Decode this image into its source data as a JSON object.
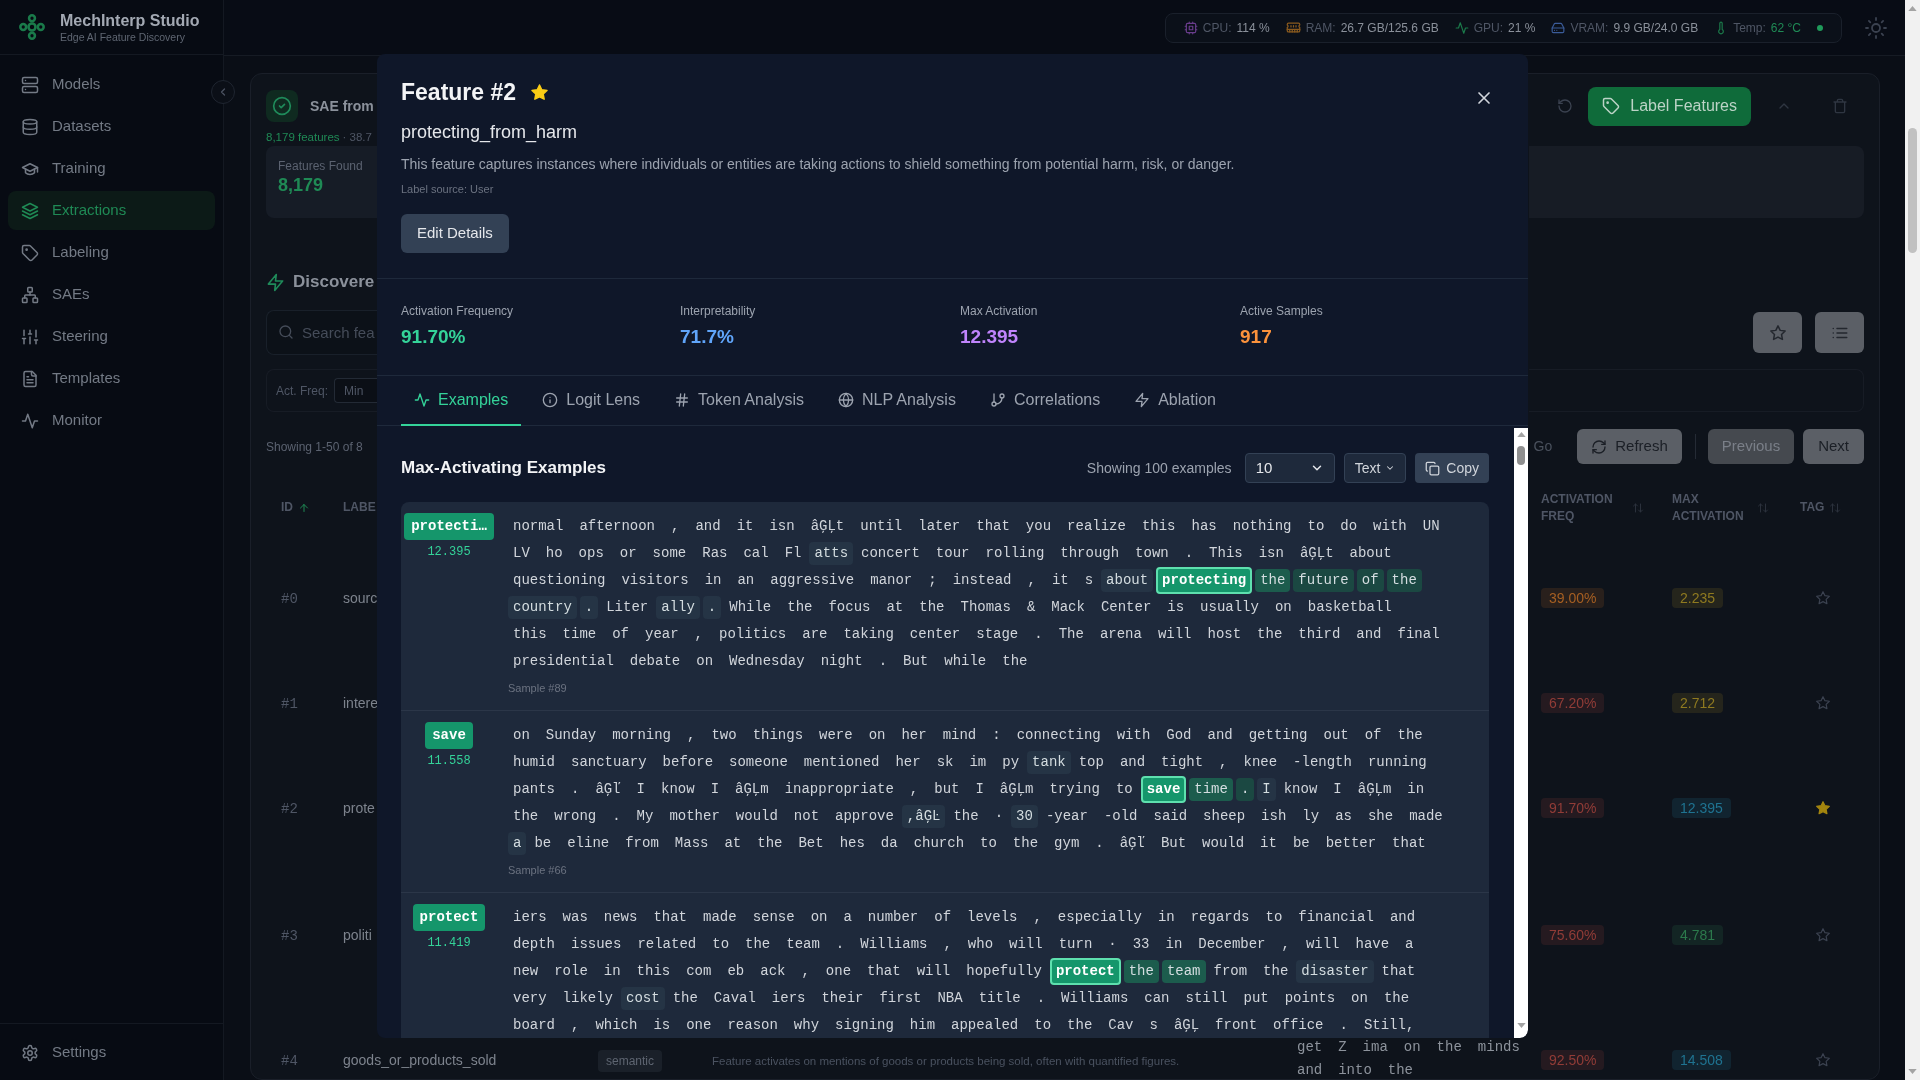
{
  "app": {
    "title": "MechInterp Studio",
    "subtitle": "Edge AI Feature Discovery"
  },
  "sidebar": {
    "items": [
      {
        "label": "Models",
        "selected": false
      },
      {
        "label": "Datasets",
        "selected": false
      },
      {
        "label": "Training",
        "selected": false
      },
      {
        "label": "Extractions",
        "selected": true
      },
      {
        "label": "Labeling",
        "selected": false
      },
      {
        "label": "SAEs",
        "selected": false
      },
      {
        "label": "Steering",
        "selected": false
      },
      {
        "label": "Templates",
        "selected": false
      },
      {
        "label": "Monitor",
        "selected": false
      }
    ],
    "footer_item": {
      "label": "Settings"
    }
  },
  "status_bar": {
    "items": [
      {
        "kind": "cpu",
        "label": "CPU:",
        "value": "114 %"
      },
      {
        "kind": "ram",
        "label": "RAM:",
        "value": "26.7 GB/125.6 GB"
      },
      {
        "kind": "gpu",
        "label": "GPU:",
        "value": "21 %"
      },
      {
        "kind": "vram",
        "label": "VRAM:",
        "value": "9.9 GB/24.0 GB"
      },
      {
        "kind": "temp",
        "label": "Temp:",
        "value": "62 °C"
      }
    ],
    "online": true
  },
  "extraction": {
    "title": "SAE from",
    "features": "8,179 features",
    "meta": "· 38.7",
    "stat": {
      "label": "Features Found",
      "value": "8,179"
    },
    "label_button": "Label Features"
  },
  "features_section": {
    "title": "Discovere",
    "search": {
      "placeholder": "Search fea"
    },
    "filter": {
      "label": "Act. Freq:",
      "min": {
        "placeholder": "Min"
      }
    },
    "showing": "Showing 1-50 of 8",
    "go": {
      "label": "Go",
      "disabled": true
    },
    "refresh": "Refresh",
    "previous": {
      "label": "Previous",
      "disabled": true
    },
    "next": {
      "label": "Next",
      "disabled": false
    }
  },
  "table": {
    "columns": [
      {
        "label": "ID",
        "sortable": true,
        "sorted": true
      },
      {
        "label": "LABE"
      },
      {
        "label": "ACTIVATION FREQ",
        "sortable": true,
        "sorted": false
      },
      {
        "label": "MAX ACTIVATION",
        "sortable": true,
        "sorted": false
      },
      {
        "label": "TAG",
        "sortable": true,
        "sorted": false
      }
    ],
    "rows": [
      {
        "id": "#0",
        "label": "sourc",
        "activation_freq": {
          "text": "39.00%",
          "color": "#a65f22"
        },
        "max_activation": {
          "text": "2.235",
          "color": "#8f7a20"
        },
        "starred": false
      },
      {
        "id": "#1",
        "label": "intere",
        "activation_freq": {
          "text": "67.20%",
          "color": "#913c37"
        },
        "max_activation": {
          "text": "2.712",
          "color": "#8f7a20"
        },
        "starred": false
      },
      {
        "id": "#2",
        "label": "prote",
        "activation_freq": {
          "text": "91.70%",
          "color": "#913c37"
        },
        "max_activation": {
          "text": "12.395",
          "color": "#1f7391"
        },
        "starred": true
      },
      {
        "id": "#3",
        "label": "politi",
        "activation_freq": {
          "text": "75.60%",
          "color": "#913c37"
        },
        "max_activation": {
          "text": "4.781",
          "color": "#2c7a4c"
        },
        "starred": false
      },
      {
        "id": "#4",
        "label": "goods_or_products_sold",
        "category": "semantic",
        "description": "Feature activates on mentions of goods or products being sold, often with quantified figures.",
        "activation_freq": {
          "text": "92.50%",
          "color": "#913c37"
        },
        "max_activation": {
          "text": "14.508",
          "color": "#1f7391"
        },
        "starred": false
      }
    ]
  },
  "modal": {
    "title": "Feature #2",
    "starred": true,
    "name": "protecting_from_harm",
    "description": "This feature captures instances where individuals or entities are taking actions to shield something from potential harm, risk, or danger.",
    "label_source": "Label source: User",
    "edit_button": "Edit Details",
    "stats": [
      {
        "label": "Activation Frequency",
        "value": "91.70%",
        "color": "#34d399"
      },
      {
        "label": "Interpretability",
        "value": "71.7%",
        "color": "#60a5fa"
      },
      {
        "label": "Max Activation",
        "value": "12.395",
        "color": "#c084fc"
      },
      {
        "label": "Active Samples",
        "value": "917",
        "color": "#fb923c"
      }
    ],
    "tabs": [
      {
        "label": "Examples",
        "selected": true
      },
      {
        "label": "Logit Lens",
        "selected": false
      },
      {
        "label": "Token Analysis",
        "selected": false
      },
      {
        "label": "NLP Analysis",
        "selected": false
      },
      {
        "label": "Correlations",
        "selected": false
      },
      {
        "label": "Ablation",
        "selected": false
      }
    ],
    "examples_panel": {
      "title": "Max-Activating Examples",
      "count": "Showing 100 examples",
      "page_size": "10",
      "view": "Text",
      "copy_button": "Copy",
      "examples": [
        {
          "token": "protecti…",
          "activation": "12.395",
          "lines": [
            [
              {
                "text": "normal afternoon , and it isn âĢĻt until later that you realize this has nothing to do with UN"
              }
            ],
            [
              {
                "text": "LV ho ops or some Ras cal Fl"
              },
              {
                "text": "atts",
                "color": "#253445",
                "peak": false
              },
              {
                "text": "concert tour rolling through town . This isn âĢĻt about"
              }
            ],
            [
              {
                "text": "questioning visitors in an aggressive manor ; instead , it s"
              },
              {
                "text": "about",
                "color": "#253445",
                "peak": false
              },
              {
                "text": "protecting",
                "color": "#15966b",
                "peak": true
              },
              {
                "text": "the",
                "color": "#1c5c4d",
                "peak": false
              },
              {
                "text": "future",
                "color": "#1b4842",
                "peak": false
              },
              {
                "text": "of",
                "color": "#1b4842",
                "peak": false
              },
              {
                "text": "the",
                "color": "#1b4842",
                "peak": false
              }
            ],
            [
              {
                "text": "country",
                "color": "#253445",
                "peak": false
              },
              {
                "text": ".",
                "color": "#253445",
                "peak": false
              },
              {
                "text": "Liter"
              },
              {
                "text": "ally",
                "color": "#253445",
                "peak": false
              },
              {
                "text": ".",
                "color": "#253445",
                "peak": false
              },
              {
                "text": "While the focus at the Thomas & Mack Center is usually on basketball"
              }
            ],
            [
              {
                "text": "this time of year , politics are taking center stage . The arena will host the third and final"
              }
            ],
            [
              {
                "text": "presidential debate on Wednesday night . But while the"
              }
            ]
          ],
          "sample": "Sample #89"
        },
        {
          "token": "save",
          "activation": "11.558",
          "lines": [
            [
              {
                "text": "on Sunday morning , two things were on her mind : connecting with God and getting out of the"
              }
            ],
            [
              {
                "text": "humid sanctuary before someone mentioned her sk im py"
              },
              {
                "text": "tank",
                "color": "#253445",
                "peak": false
              },
              {
                "text": "top and tight , knee -length running"
              }
            ],
            [
              {
                "text": "pants . âĢľ I know I âĢĻm inappropriate , but I âĢĻm trying to"
              },
              {
                "text": "save",
                "color": "#15966b",
                "peak": true
              },
              {
                "text": "time",
                "color": "#1c5c4d",
                "peak": false
              },
              {
                "text": ".",
                "color": "#1b4842",
                "peak": false
              },
              {
                "text": "I",
                "color": "#253445",
                "peak": false
              },
              {
                "text": "know I âĢĻm in"
              }
            ],
            [
              {
                "text": "the wrong . My mother would not approve"
              },
              {
                "text": ",âĢĿ",
                "color": "#253445",
                "peak": false
              },
              {
                "text": "the ·"
              },
              {
                "text": "30",
                "color": "#253445",
                "peak": false
              },
              {
                "text": "-year -old said sheep ish ly as she made"
              }
            ],
            [
              {
                "text": "a",
                "color": "#253445",
                "peak": false
              },
              {
                "text": "be eline from Mass at the Bet hes da church to the gym . âĢľ But would it be better that"
              }
            ]
          ],
          "sample": "Sample #66"
        },
        {
          "token": "protect",
          "activation": "11.419",
          "lines": [
            [
              {
                "text": "iers was news that made sense on a number of levels , especially in regards to financial and"
              }
            ],
            [
              {
                "text": "depth issues related to the team . Williams , who will turn · 33 in December , will have a"
              }
            ],
            [
              {
                "text": "new role in this com eb ack , one that will hopefully"
              },
              {
                "text": "protect",
                "color": "#15966b",
                "peak": true
              },
              {
                "text": "the",
                "color": "#1c5c4d",
                "peak": false
              },
              {
                "text": "team",
                "color": "#1c5c4d",
                "peak": false
              },
              {
                "text": "from the"
              },
              {
                "text": "disaster",
                "color": "#253445",
                "peak": false
              },
              {
                "text": "that"
              }
            ],
            [
              {
                "text": "very likely"
              },
              {
                "text": "cost",
                "color": "#253445",
                "peak": false
              },
              {
                "text": "the Caval iers their first NBA title . Williams can still put points on the"
              }
            ],
            [
              {
                "text": "board , which is one reason why signing him appealed to the Cav s âĢĻ front office . Still,"
              }
            ]
          ]
        }
      ]
    }
  },
  "overflow_text": [
    "get Z ima on the minds",
    "and into the"
  ]
}
